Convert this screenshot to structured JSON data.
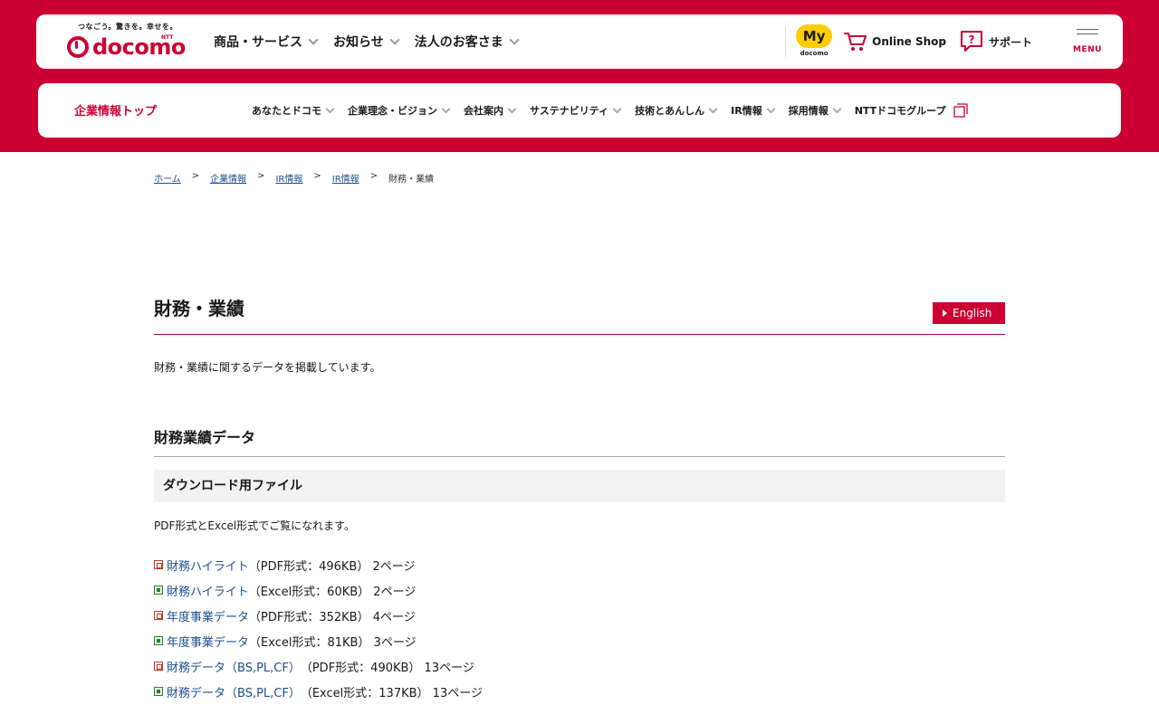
{
  "brand": {
    "tagline": "つなごう。驚きを。幸せを。",
    "ntt_mark": "NTT",
    "logo_text": "docomo",
    "brand_color": "#cc0033"
  },
  "header": {
    "nav": [
      {
        "label": "商品・サービス"
      },
      {
        "label": "お知らせ"
      },
      {
        "label": "法人のお客さま"
      }
    ],
    "mydocomo": {
      "badge": "My",
      "sub": "docomo"
    },
    "online_shop": "Online Shop",
    "support": "サポート",
    "menu": "MENU"
  },
  "corp_nav": {
    "top_label": "企業情報トップ",
    "items": [
      {
        "label": "あなたとドコモ"
      },
      {
        "label": "企業理念・ビジョン"
      },
      {
        "label": "会社案内"
      },
      {
        "label": "サステナビリティ"
      },
      {
        "label": "技術とあんしん"
      },
      {
        "label": "IR情報"
      },
      {
        "label": "採用情報"
      },
      {
        "label": "NTTドコモグループ"
      }
    ]
  },
  "breadcrumb": {
    "links": [
      {
        "label": "ホーム"
      },
      {
        "label": "企業情報"
      },
      {
        "label": "IR情報"
      },
      {
        "label": "IR情報"
      }
    ],
    "separator": ">",
    "current": "財務・業績"
  },
  "page": {
    "title": "財務・業績",
    "english_label": "English",
    "intro": "財務・業績に関するデータを掲載しています。",
    "section_title": "財務業績データ",
    "subsection_title": "ダウンロード用ファイル",
    "file_note": "PDF形式とExcel形式でご覧になれます。",
    "files": [
      {
        "type": "pdf",
        "name": "財務ハイライト",
        "meta": "（PDF形式：496KB）  2ページ"
      },
      {
        "type": "xls",
        "name": "財務ハイライト",
        "meta": "（Excel形式：60KB）  2ページ"
      },
      {
        "type": "pdf",
        "name": "年度事業データ",
        "meta": "（PDF形式：352KB）  4ページ"
      },
      {
        "type": "xls",
        "name": "年度事業データ",
        "meta": "（Excel形式：81KB）  3ページ"
      },
      {
        "type": "pdf",
        "name": "財務データ（BS,PL,CF）",
        "meta": "（PDF形式：490KB）  13ページ"
      },
      {
        "type": "xls",
        "name": "財務データ（BS,PL,CF）",
        "meta": "（Excel形式：137KB）  13ページ"
      }
    ]
  }
}
